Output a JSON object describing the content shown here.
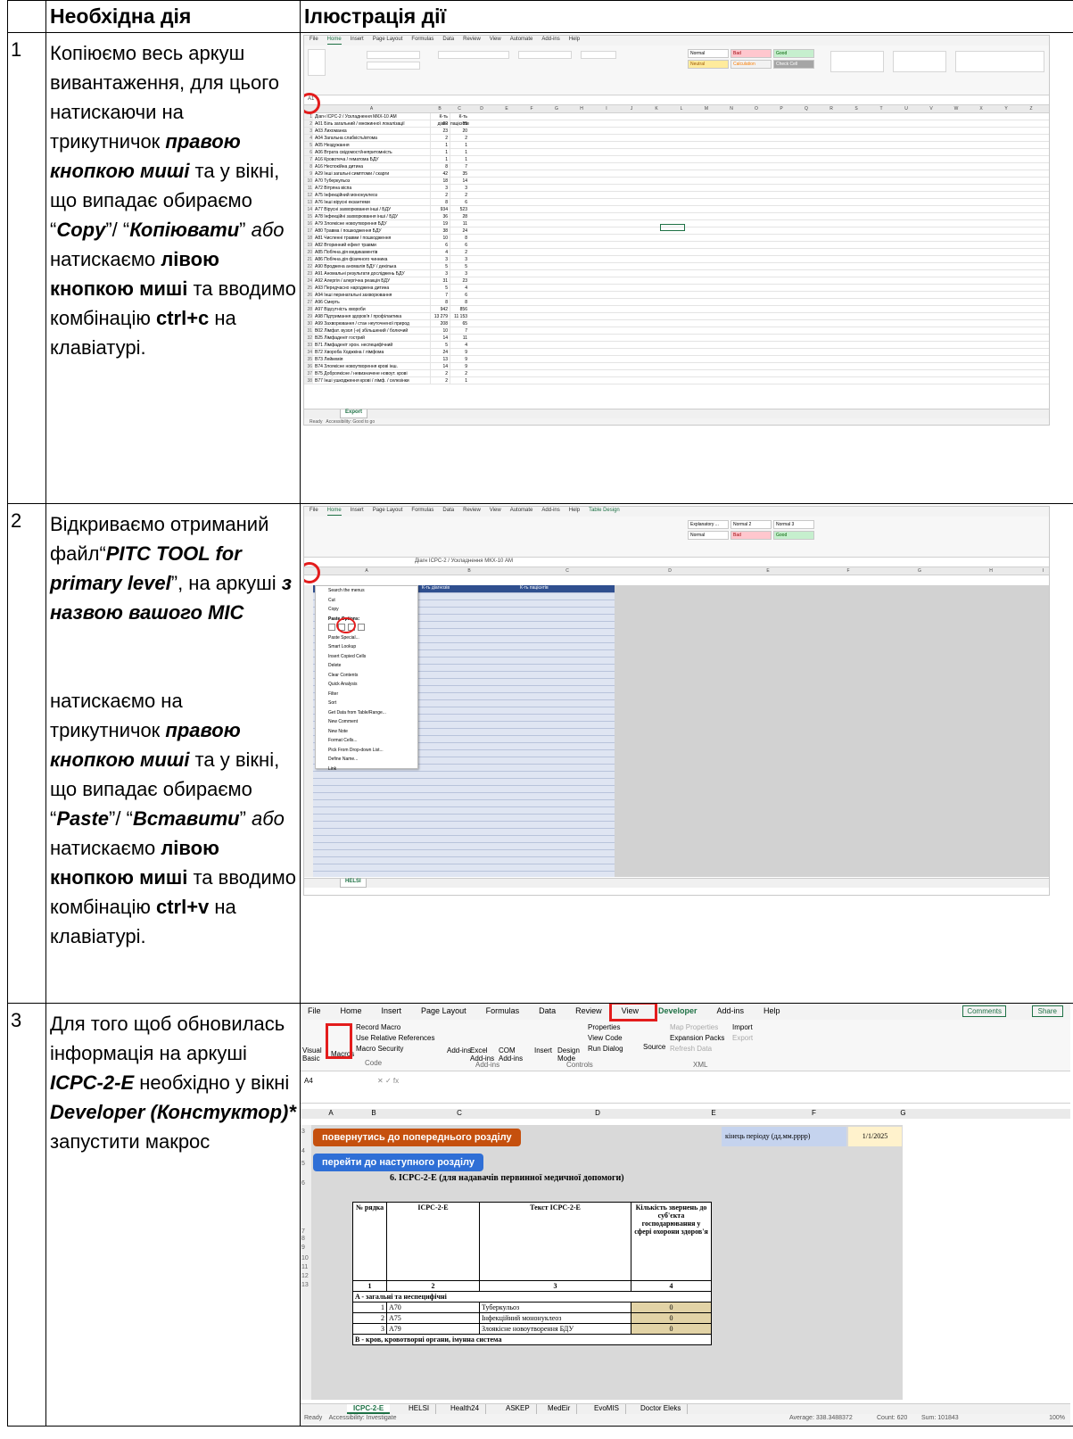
{
  "header": {
    "col1": "",
    "col2": "Необхідна дія",
    "col3": "Ілюстрація дії"
  },
  "steps": [
    {
      "number": "1",
      "text_parts": [
        "Копіюємо весь аркуш вивантаження, для цього натискаючи на трикутничок ",
        "правою кнопкою миші",
        " та у вікні, що випадає обираємо “",
        "Copy",
        "”/ “",
        "Копіювати",
        "” ",
        "або",
        " натискаємо ",
        "лівою кнопкою миші",
        " та вводимо комбінацію ",
        "ctrl+c",
        " на клавіатурі."
      ]
    },
    {
      "number": "2",
      "text_parts": [
        "Відкриваємо отриманий файл“",
        "PITC TOOL for primary level",
        "”, на аркуші ",
        "з назвою вашого МІС",
        "натискаємо на трикутничок ",
        "правою кнопкою миші",
        " та у вікні, що випадає обираємо “",
        "Paste",
        "”/ “",
        "Вставити",
        "” ",
        "або",
        " натискаємо ",
        "лівою кнопкою миші",
        " та вводимо комбінацію ",
        "ctrl+v",
        " на клавіатурі."
      ]
    },
    {
      "number": "3",
      "text_parts": [
        "Для того щоб обновилась інформація на аркуші ",
        "ICPC-2-E",
        " необхідно у вікні ",
        "Developer (Констуктор)*",
        " запустити макрос"
      ]
    }
  ],
  "shot1": {
    "menu": [
      "File",
      "Home",
      "Insert",
      "Page Layout",
      "Formulas",
      "Data",
      "Review",
      "View",
      "Automate",
      "Add-ins",
      "Help"
    ],
    "styles": [
      "Normal",
      "Bad",
      "Good",
      "Neutral",
      "Calculation",
      "Check Cell"
    ],
    "name_box": "A1",
    "col_headers": [
      "A",
      "B",
      "C",
      "D",
      "E",
      "F",
      "G",
      "H",
      "I",
      "J",
      "K",
      "L",
      "M",
      "N",
      "O",
      "P",
      "Q",
      "R",
      "S",
      "T",
      "U",
      "V",
      "W",
      "X",
      "Y",
      "Z"
    ],
    "rows": [
      [
        "1",
        "Діагн ICPC-2 / Ускладнення МКХ-10 АМ",
        "К-ть діагн",
        "К-ть пацієнтів"
      ],
      [
        "2",
        "A01 Біль загальний / множинної локалізації",
        "62",
        "55"
      ],
      [
        "3",
        "A03 Лихоманка",
        "23",
        "20"
      ],
      [
        "4",
        "A04 Загальна слабкість/втома",
        "2",
        "2"
      ],
      [
        "5",
        "A05 Нездужання",
        "1",
        "1"
      ],
      [
        "6",
        "A06 Втрата свідомості/непритомність",
        "1",
        "1"
      ],
      [
        "7",
        "A16 Кровотеча / гематома БДУ",
        "1",
        "1"
      ],
      [
        "8",
        "A16 Неспокійна дитина",
        "8",
        "7"
      ],
      [
        "9",
        "A29 Інші загальні симптоми / скарги",
        "42",
        "35"
      ],
      [
        "10",
        "A70 Туберкульоз",
        "18",
        "14"
      ],
      [
        "11",
        "A72 Вітряна віспа",
        "3",
        "3"
      ],
      [
        "12",
        "A75 Інфекційний мононуклеоз",
        "2",
        "2"
      ],
      [
        "13",
        "A76 Інші вірусні екзантеми",
        "8",
        "6"
      ],
      [
        "14",
        "A77 Вірусні захворювання інші / БДУ",
        "934",
        "523"
      ],
      [
        "15",
        "A78 Інфекційні захворювання інші / БДУ",
        "36",
        "28"
      ],
      [
        "16",
        "A79 Злоякісне новоутворення БДУ",
        "19",
        "11"
      ],
      [
        "17",
        "A80 Травма / пошкодження БДУ",
        "38",
        "24"
      ],
      [
        "18",
        "A81 Численні травми / пошкодження",
        "10",
        "8"
      ],
      [
        "19",
        "A82 Вторинний ефект травми",
        "6",
        "6"
      ],
      [
        "20",
        "A85 Побічна дія медикаментів",
        "4",
        "2"
      ],
      [
        "21",
        "A86 Побічна дія фізичного чинника",
        "3",
        "3"
      ],
      [
        "22",
        "A90 Вроджена аномалія БДУ / декілька",
        "5",
        "5"
      ],
      [
        "23",
        "A91 Аномальні результати досліджень БДУ",
        "3",
        "3"
      ],
      [
        "24",
        "A92 Алергія / алергічна реакція БДУ",
        "31",
        "23"
      ],
      [
        "25",
        "A93 Передчасно народжена дитина",
        "5",
        "4"
      ],
      [
        "26",
        "A94 Інші перинатальні захворювання",
        "7",
        "6"
      ],
      [
        "27",
        "A96 Смерть",
        "8",
        "8"
      ],
      [
        "28",
        "A97 Відсутність хвороби",
        "942",
        "856"
      ],
      [
        "29",
        "A98 Підтримання здоров'я / профілактика",
        "13 279",
        "11 153"
      ],
      [
        "30",
        "A99 Захворювання / стан неуточненої природ",
        "208",
        "65"
      ],
      [
        "31",
        "B02 Лімфат. вузол (-и) збільшений / болючий",
        "10",
        "7"
      ],
      [
        "32",
        "B25 Лімфаденіт гострий",
        "14",
        "11"
      ],
      [
        "33",
        "B71 Лімфаденіт хрон. неспецифічний",
        "5",
        "4"
      ],
      [
        "34",
        "B72 Хвороба Ходжкіна / лімфома",
        "24",
        "9"
      ],
      [
        "35",
        "B73 Лейкемія",
        "13",
        "9"
      ],
      [
        "36",
        "B74 Злоякісне новоутворення крові інш.",
        "14",
        "9"
      ],
      [
        "37",
        "B75 Доброякісне / невизначене новоут. крові",
        "2",
        "2"
      ],
      [
        "38",
        "B77 Інші ушкодження крові / лімф. / селезінки",
        "2",
        "1"
      ]
    ],
    "sheet_tab": "Export",
    "status": "Ready",
    "accessibility": "Accessibility: Good to go"
  },
  "shot2": {
    "menu": [
      "File",
      "Home",
      "Insert",
      "Page Layout",
      "Formulas",
      "Data",
      "Review",
      "View",
      "Automate",
      "Add-ins",
      "Help",
      "Table Design"
    ],
    "styles": [
      "Explanatory ...",
      "Normal 2",
      "Normal 3",
      "Normal",
      "Bad",
      "Good"
    ],
    "formula": "Діагн ICPC-2 / Ускладнення МКХ-10 АМ",
    "col_headers": [
      "A",
      "B",
      "C",
      "D",
      "E",
      "F",
      "G",
      "H",
      "I"
    ],
    "table_headers": [
      "Діагн ICPC-2 / Ускладнення МКХ-10 АМ",
      "К-ть діагнозів",
      "К-ть пацієнтів"
    ],
    "menu_items": [
      "Search the menus",
      "Cut",
      "Copy",
      "Paste Options:",
      "Paste Special...",
      "Smart Lookup",
      "Insert Copied Cells",
      "Delete",
      "Clear Contents",
      "Quick Analysis",
      "Filter",
      "Sort",
      "Get Data from Table/Range...",
      "New Comment",
      "New Note",
      "Format Cells...",
      "Pick From Drop-down List...",
      "Define Name...",
      "Link"
    ],
    "sheet_tab": "HELSI"
  },
  "shot3": {
    "menu": [
      "File",
      "Home",
      "Insert",
      "Page Layout",
      "Formulas",
      "Data",
      "Review",
      "View",
      "Developer",
      "Add-ins",
      "Help"
    ],
    "comments": "Comments",
    "share": "Share",
    "ribbon": {
      "visual_basic": "Visual Basic",
      "macros": "Macros",
      "record_macro": "Record Macro",
      "relative_refs": "Use Relative References",
      "macro_security": "Macro Security",
      "code_group": "Code",
      "add_ins": "Add-ins",
      "excel_add_ins": "Excel Add-ins",
      "com_add_ins": "COM Add-ins",
      "add_ins_group": "Add-ins",
      "insert": "Insert",
      "design_mode": "Design Mode",
      "properties": "Properties",
      "view_code": "View Code",
      "run_dialog": "Run Dialog",
      "controls_group": "Controls",
      "source": "Source",
      "map_properties": "Map Properties",
      "expansion_packs": "Expansion Packs",
      "refresh_data": "Refresh Data",
      "import": "Import",
      "export": "Export",
      "xml_group": "XML"
    },
    "name_box": "A4",
    "col_headers": [
      "A",
      "B",
      "C",
      "D",
      "E",
      "F",
      "G"
    ],
    "row_nums": [
      "3",
      "4",
      "5",
      "6",
      "7",
      "8",
      "9",
      "10",
      "11",
      "12",
      "13"
    ],
    "btn_back": "повернутись до попереднього розділу",
    "btn_next": "перейти до наступного розділу",
    "period_label": "кінець періоду (дд.мм.рррр)",
    "period_value": "1/1/2025",
    "section_title": "6. ICPC-2-E (для надавачів первинної медичної допомоги)",
    "table": {
      "h_row": "№ рядка",
      "h_code": "ICPC-2-E",
      "h_text": "Текст ICPC-2-E",
      "h_count": "Кількість звернень до суб'єкта господарювання у сфері охорони здоров'я",
      "n1": "1",
      "n2": "2",
      "n3": "3",
      "n4": "4",
      "group_a": "A - загальні та неспецифічні",
      "rows": [
        [
          "1",
          "A70",
          "Туберкульоз",
          "0"
        ],
        [
          "2",
          "A75",
          "Інфекційний мононуклеоз",
          "0"
        ],
        [
          "3",
          "A79",
          "Злоякісне новоутворення БДУ",
          "0"
        ]
      ],
      "group_b": "B - кров, кровотворні органи, імунна система"
    },
    "tabs": [
      "ICPC-2-E",
      "HELSI",
      "Health24",
      "ASKEP",
      "MedEir",
      "EvoMIS",
      "Doctor Eleks"
    ],
    "status": "Ready",
    "accessibility": "Accessibility: Investigate",
    "average": "Average: 338.3488372",
    "count": "Count: 620",
    "sum": "Sum: 101843",
    "zoom": "100%"
  }
}
